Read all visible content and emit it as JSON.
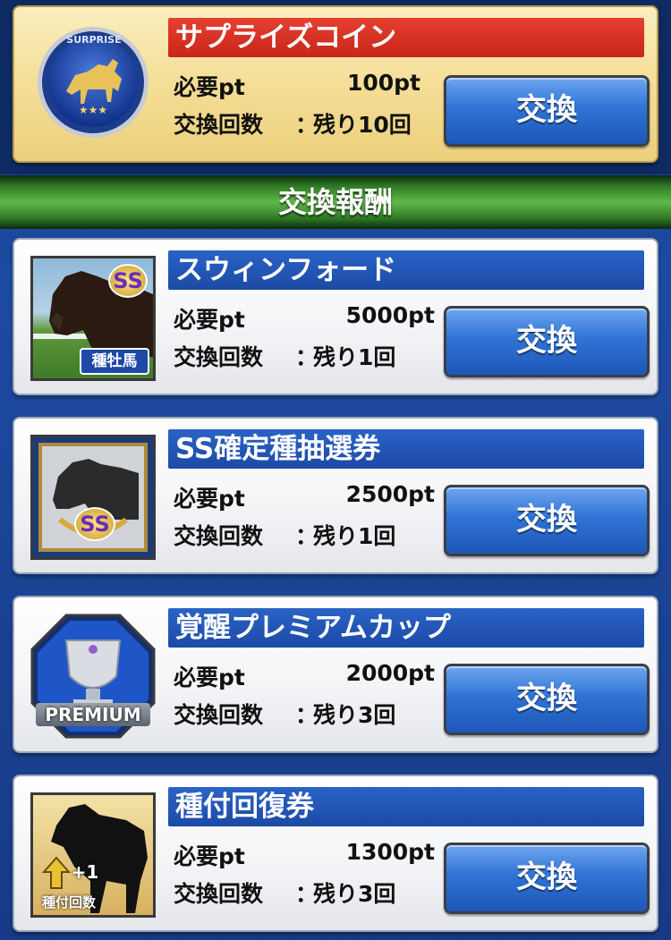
{
  "featured": {
    "title": "サプライズコイン",
    "badge_text": "SURPRISE",
    "required_label": "必要pt",
    "required_value": "100pt",
    "count_label": "交換回数",
    "colon": "：",
    "count_value": "残り10回",
    "button_label": "交換"
  },
  "section": {
    "title": "交換報酬"
  },
  "items": [
    {
      "title": "スウィンフォード",
      "required_label": "必要pt",
      "required_value": "5000pt",
      "count_label": "交換回数",
      "colon": "：",
      "count_value": "残り1回",
      "button_label": "交換",
      "thumb_badge": "SS",
      "thumb_caption": "種牡馬"
    },
    {
      "title": "SS確定種抽選券",
      "required_label": "必要pt",
      "required_value": "2500pt",
      "count_label": "交換回数",
      "colon": "：",
      "count_value": "残り1回",
      "button_label": "交換",
      "thumb_badge": "SS"
    },
    {
      "title": "覚醒プレミアムカップ",
      "required_label": "必要pt",
      "required_value": "2000pt",
      "count_label": "交換回数",
      "colon": "：",
      "count_value": "残り3回",
      "button_label": "交換",
      "thumb_caption": "PREMIUM"
    },
    {
      "title": "種付回復券",
      "required_label": "必要pt",
      "required_value": "1300pt",
      "count_label": "交換回数",
      "colon": "：",
      "count_value": "残り3回",
      "button_label": "交換",
      "thumb_badge": "+1",
      "thumb_caption": "種付回数"
    }
  ],
  "colors": {
    "accent_blue": "#1c4aa6",
    "accent_red": "#c9251a",
    "section_green": "#5fb84a"
  }
}
